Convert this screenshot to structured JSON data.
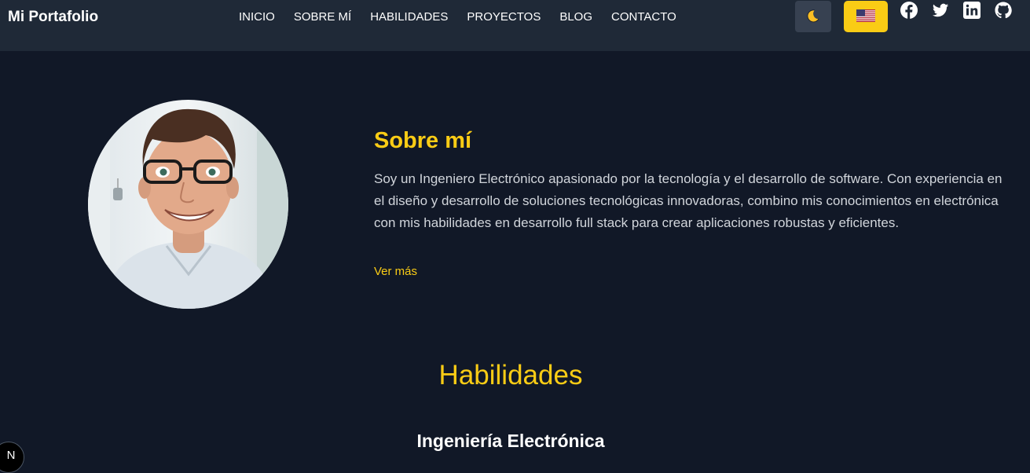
{
  "header": {
    "brand": "Mi Portafolio",
    "nav": [
      {
        "label": "INICIO"
      },
      {
        "label": "SOBRE MÍ"
      },
      {
        "label": "HABILIDADES"
      },
      {
        "label": "PROYECTOS"
      },
      {
        "label": "BLOG"
      },
      {
        "label": "CONTACTO"
      }
    ],
    "theme_toggle_icon": "moon-icon",
    "language_button_icon": "us-flag-icon",
    "social_icons": [
      "facebook-icon",
      "twitter-icon",
      "linkedin-icon",
      "github-icon"
    ]
  },
  "about": {
    "title": "Sobre mí",
    "text": "Soy un Ingeniero Electrónico apasionado por la tecnología y el desarrollo de software. Con experiencia en el diseño y desarrollo de soluciones tecnológicas innovadoras, combino mis conocimientos en electrónica con mis habilidades en desarrollo full stack para crear aplicaciones robustas y eficientes.",
    "more_link": "Ver más",
    "avatar_icon": "profile-avatar"
  },
  "skills": {
    "title": "Habilidades",
    "subtitle": "Ingeniería Electrónica"
  },
  "dev_badge": {
    "label": "N"
  },
  "colors": {
    "background": "#111827",
    "navbar": "#1f2937",
    "accent": "#facc15",
    "text": "#d1d5db"
  }
}
